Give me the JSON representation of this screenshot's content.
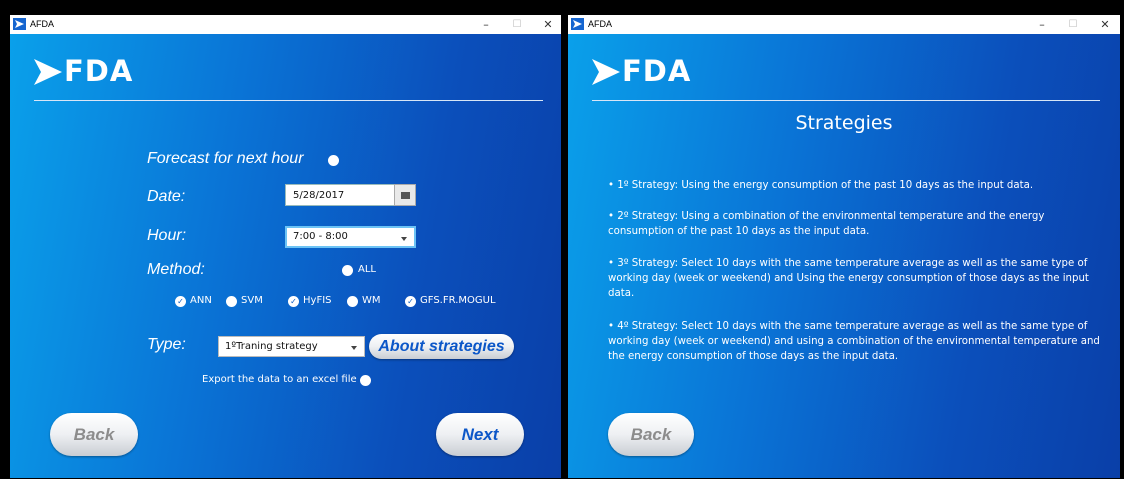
{
  "win1": {
    "title": "AFDA",
    "controls": {
      "minimize": "–",
      "maximize": "☐",
      "close": "✕"
    },
    "logo": "FDA",
    "forecast_label": "Forecast for next hour",
    "date_label": "Date:",
    "date_value": "5/28/2017",
    "hour_label": "Hour:",
    "hour_value": "7:00 - 8:00",
    "method_label": "Method:",
    "all_label": "ALL",
    "methods": [
      {
        "label": "ANN",
        "checked": true
      },
      {
        "label": "SVM",
        "checked": false
      },
      {
        "label": "HyFIS",
        "checked": true
      },
      {
        "label": "WM",
        "checked": false
      },
      {
        "label": "GFS.FR.MOGUL",
        "checked": true
      }
    ],
    "type_label": "Type:",
    "type_value": "1ºTraning strategy",
    "about_label": "About strategies",
    "export_label": "Export the data to an excel file",
    "back_label": "Back",
    "next_label": "Next"
  },
  "win2": {
    "title": "AFDA",
    "controls": {
      "minimize": "–",
      "maximize": "☐",
      "close": "✕"
    },
    "logo": "FDA",
    "heading": "Strategies",
    "strategies": [
      "• 1º Strategy: Using the energy consumption of the past 10 days as the input data.",
      "• 2º Strategy: Using a combination of the environmental temperature and the energy consumption of the past 10 days as the input data.",
      "• 3º Strategy: Select 10 days with the same temperature average as well as the same type of working day (week or weekend) and Using the energy consumption of those days as the input data.",
      "• 4º Strategy: Select 10 days with the same temperature average as well as the same type of working day (week or weekend) and using a combination of the environmental temperature and the energy consumption of those days as the input data."
    ],
    "back_label": "Back"
  },
  "colors": {
    "accent": "#0a5cc4",
    "bg_light": "#0aa0ea",
    "bg_dark": "#0a3fa8"
  },
  "icons": [
    "app-logo-icon",
    "calendar-icon",
    "chevron-down-icon",
    "check-icon",
    "radio-icon"
  ]
}
